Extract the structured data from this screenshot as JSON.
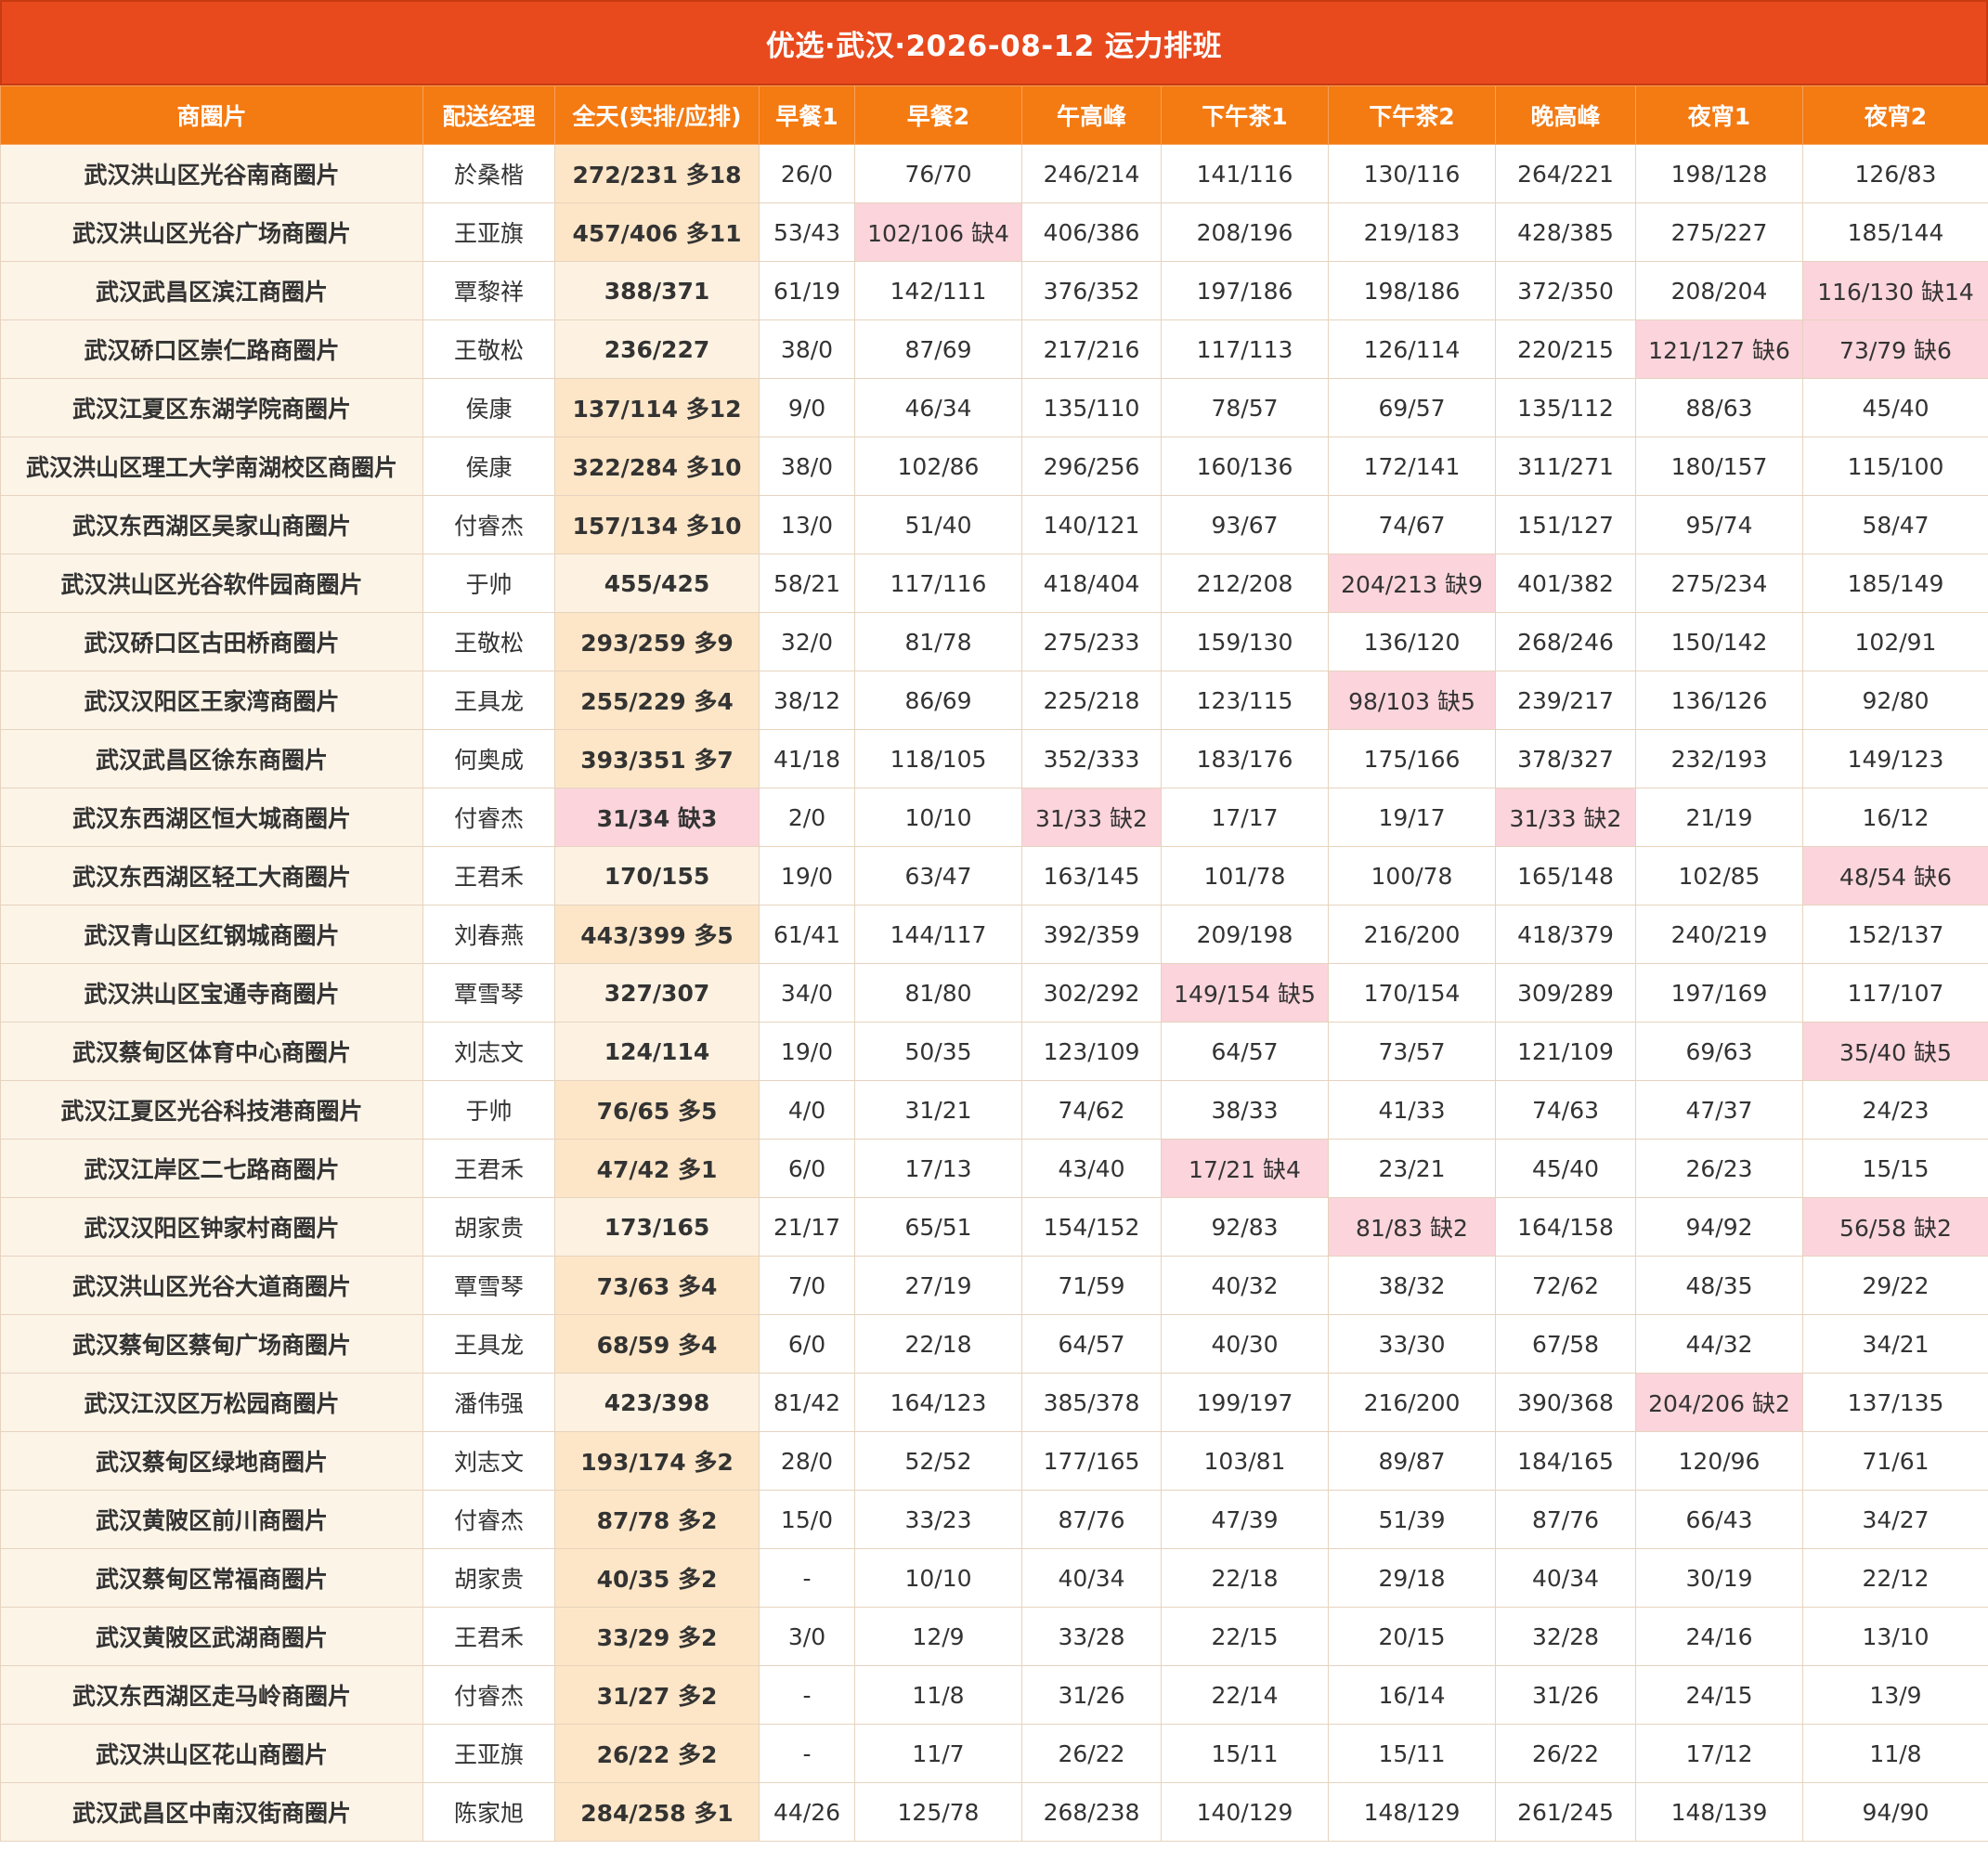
{
  "title": "优选·武汉·2026-08-12 运力排班",
  "headers": [
    "商圈片",
    "配送经理",
    "全天(实排/应排)",
    "早餐1",
    "早餐2",
    "午高峰",
    "下午茶1",
    "下午茶2",
    "晚高峰",
    "夜宵1",
    "夜宵2"
  ],
  "colors": {
    "title_bg": "#e84a1e",
    "header_bg": "#f47a12",
    "shortage_bg": "#fbd4dc",
    "total_bg": "#fde6c7"
  },
  "rows": [
    {
      "area": "武汉洪山区光谷南商圈片",
      "manager": "於桑楷",
      "total": "272/231 多18",
      "slots": [
        "26/0",
        "76/70",
        "246/214",
        "141/116",
        "130/116",
        "264/221",
        "198/128",
        "126/83"
      ]
    },
    {
      "area": "武汉洪山区光谷广场商圈片",
      "manager": "王亚旗",
      "total": "457/406 多11",
      "slots": [
        "53/43",
        "102/106 缺4",
        "406/386",
        "208/196",
        "219/183",
        "428/385",
        "275/227",
        "185/144"
      ]
    },
    {
      "area": "武汉武昌区滨江商圈片",
      "manager": "覃黎祥",
      "total": "388/371",
      "slots": [
        "61/19",
        "142/111",
        "376/352",
        "197/186",
        "198/186",
        "372/350",
        "208/204",
        "116/130 缺14"
      ]
    },
    {
      "area": "武汉硚口区崇仁路商圈片",
      "manager": "王敬松",
      "total": "236/227",
      "slots": [
        "38/0",
        "87/69",
        "217/216",
        "117/113",
        "126/114",
        "220/215",
        "121/127 缺6",
        "73/79 缺6"
      ]
    },
    {
      "area": "武汉江夏区东湖学院商圈片",
      "manager": "侯康",
      "total": "137/114 多12",
      "slots": [
        "9/0",
        "46/34",
        "135/110",
        "78/57",
        "69/57",
        "135/112",
        "88/63",
        "45/40"
      ]
    },
    {
      "area": "武汉洪山区理工大学南湖校区商圈片",
      "manager": "侯康",
      "total": "322/284 多10",
      "slots": [
        "38/0",
        "102/86",
        "296/256",
        "160/136",
        "172/141",
        "311/271",
        "180/157",
        "115/100"
      ]
    },
    {
      "area": "武汉东西湖区吴家山商圈片",
      "manager": "付睿杰",
      "total": "157/134 多10",
      "slots": [
        "13/0",
        "51/40",
        "140/121",
        "93/67",
        "74/67",
        "151/127",
        "95/74",
        "58/47"
      ]
    },
    {
      "area": "武汉洪山区光谷软件园商圈片",
      "manager": "于帅",
      "total": "455/425",
      "slots": [
        "58/21",
        "117/116",
        "418/404",
        "212/208",
        "204/213 缺9",
        "401/382",
        "275/234",
        "185/149"
      ]
    },
    {
      "area": "武汉硚口区古田桥商圈片",
      "manager": "王敬松",
      "total": "293/259 多9",
      "slots": [
        "32/0",
        "81/78",
        "275/233",
        "159/130",
        "136/120",
        "268/246",
        "150/142",
        "102/91"
      ]
    },
    {
      "area": "武汉汉阳区王家湾商圈片",
      "manager": "王具龙",
      "total": "255/229 多4",
      "slots": [
        "38/12",
        "86/69",
        "225/218",
        "123/115",
        "98/103 缺5",
        "239/217",
        "136/126",
        "92/80"
      ]
    },
    {
      "area": "武汉武昌区徐东商圈片",
      "manager": "何奥成",
      "total": "393/351 多7",
      "slots": [
        "41/18",
        "118/105",
        "352/333",
        "183/176",
        "175/166",
        "378/327",
        "232/193",
        "149/123"
      ]
    },
    {
      "area": "武汉东西湖区恒大城商圈片",
      "manager": "付睿杰",
      "total": "31/34 缺3",
      "slots": [
        "2/0",
        "10/10",
        "31/33 缺2",
        "17/17",
        "19/17",
        "31/33 缺2",
        "21/19",
        "16/12"
      ]
    },
    {
      "area": "武汉东西湖区轻工大商圈片",
      "manager": "王君禾",
      "total": "170/155",
      "slots": [
        "19/0",
        "63/47",
        "163/145",
        "101/78",
        "100/78",
        "165/148",
        "102/85",
        "48/54 缺6"
      ]
    },
    {
      "area": "武汉青山区红钢城商圈片",
      "manager": "刘春燕",
      "total": "443/399 多5",
      "slots": [
        "61/41",
        "144/117",
        "392/359",
        "209/198",
        "216/200",
        "418/379",
        "240/219",
        "152/137"
      ]
    },
    {
      "area": "武汉洪山区宝通寺商圈片",
      "manager": "覃雪琴",
      "total": "327/307",
      "slots": [
        "34/0",
        "81/80",
        "302/292",
        "149/154 缺5",
        "170/154",
        "309/289",
        "197/169",
        "117/107"
      ]
    },
    {
      "area": "武汉蔡甸区体育中心商圈片",
      "manager": "刘志文",
      "total": "124/114",
      "slots": [
        "19/0",
        "50/35",
        "123/109",
        "64/57",
        "73/57",
        "121/109",
        "69/63",
        "35/40 缺5"
      ]
    },
    {
      "area": "武汉江夏区光谷科技港商圈片",
      "manager": "于帅",
      "total": "76/65 多5",
      "slots": [
        "4/0",
        "31/21",
        "74/62",
        "38/33",
        "41/33",
        "74/63",
        "47/37",
        "24/23"
      ]
    },
    {
      "area": "武汉江岸区二七路商圈片",
      "manager": "王君禾",
      "total": "47/42 多1",
      "slots": [
        "6/0",
        "17/13",
        "43/40",
        "17/21 缺4",
        "23/21",
        "45/40",
        "26/23",
        "15/15"
      ]
    },
    {
      "area": "武汉汉阳区钟家村商圈片",
      "manager": "胡家贵",
      "total": "173/165",
      "slots": [
        "21/17",
        "65/51",
        "154/152",
        "92/83",
        "81/83 缺2",
        "164/158",
        "94/92",
        "56/58 缺2"
      ]
    },
    {
      "area": "武汉洪山区光谷大道商圈片",
      "manager": "覃雪琴",
      "total": "73/63 多4",
      "slots": [
        "7/0",
        "27/19",
        "71/59",
        "40/32",
        "38/32",
        "72/62",
        "48/35",
        "29/22"
      ]
    },
    {
      "area": "武汉蔡甸区蔡甸广场商圈片",
      "manager": "王具龙",
      "total": "68/59 多4",
      "slots": [
        "6/0",
        "22/18",
        "64/57",
        "40/30",
        "33/30",
        "67/58",
        "44/32",
        "34/21"
      ]
    },
    {
      "area": "武汉江汉区万松园商圈片",
      "manager": "潘伟强",
      "total": "423/398",
      "slots": [
        "81/42",
        "164/123",
        "385/378",
        "199/197",
        "216/200",
        "390/368",
        "204/206 缺2",
        "137/135"
      ]
    },
    {
      "area": "武汉蔡甸区绿地商圈片",
      "manager": "刘志文",
      "total": "193/174 多2",
      "slots": [
        "28/0",
        "52/52",
        "177/165",
        "103/81",
        "89/87",
        "184/165",
        "120/96",
        "71/61"
      ]
    },
    {
      "area": "武汉黄陂区前川商圈片",
      "manager": "付睿杰",
      "total": "87/78 多2",
      "slots": [
        "15/0",
        "33/23",
        "87/76",
        "47/39",
        "51/39",
        "87/76",
        "66/43",
        "34/27"
      ]
    },
    {
      "area": "武汉蔡甸区常福商圈片",
      "manager": "胡家贵",
      "total": "40/35 多2",
      "slots": [
        "-",
        "10/10",
        "40/34",
        "22/18",
        "29/18",
        "40/34",
        "30/19",
        "22/12"
      ]
    },
    {
      "area": "武汉黄陂区武湖商圈片",
      "manager": "王君禾",
      "total": "33/29 多2",
      "slots": [
        "3/0",
        "12/9",
        "33/28",
        "22/15",
        "20/15",
        "32/28",
        "24/16",
        "13/10"
      ]
    },
    {
      "area": "武汉东西湖区走马岭商圈片",
      "manager": "付睿杰",
      "total": "31/27 多2",
      "slots": [
        "-",
        "11/8",
        "31/26",
        "22/14",
        "16/14",
        "31/26",
        "24/15",
        "13/9"
      ]
    },
    {
      "area": "武汉洪山区花山商圈片",
      "manager": "王亚旗",
      "total": "26/22 多2",
      "slots": [
        "-",
        "11/7",
        "26/22",
        "15/11",
        "15/11",
        "26/22",
        "17/12",
        "11/8"
      ]
    },
    {
      "area": "武汉武昌区中南汉街商圈片",
      "manager": "陈家旭",
      "total": "284/258 多1",
      "slots": [
        "44/26",
        "125/78",
        "268/238",
        "140/129",
        "148/129",
        "261/245",
        "148/139",
        "94/90"
      ]
    }
  ]
}
